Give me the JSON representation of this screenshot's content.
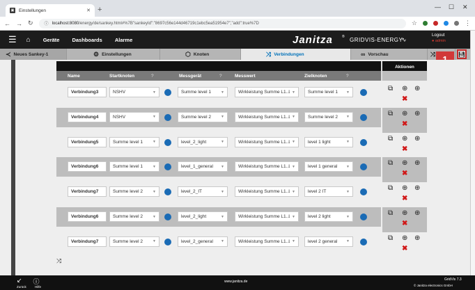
{
  "browser": {
    "tab_title": "Einstellungen",
    "url_host": "localhost:8080",
    "url_path": "/energy/de/sankey.html#%7B\"sankeyId\":\"8697c56e144d46719c1ebc5ea51954e7\",\"add\":true%7D"
  },
  "header": {
    "nav": [
      "Geräte",
      "Dashboards",
      "Alarme"
    ],
    "brand": "Janitza",
    "product": "GRIDVIS-ENERGY",
    "logout_label": "Logout",
    "user": "admin"
  },
  "tabs": {
    "back_label": "Neues Sankey-1",
    "items": [
      {
        "label": "Einstellungen",
        "icon": "gear-icon"
      },
      {
        "label": "Knoten",
        "icon": "node-icon"
      },
      {
        "label": "Verbindungen",
        "icon": "shuffle-icon"
      },
      {
        "label": "Vorschau",
        "icon": "glasses-icon"
      }
    ],
    "active": "Verbindungen",
    "callout_number": "1"
  },
  "table": {
    "headers": {
      "name": "Name",
      "start": "Startknoten",
      "device": "Messgerät",
      "value": "Messwert",
      "target": "Zielknoten",
      "actions": "Aktionen",
      "help": "?"
    },
    "rows": [
      {
        "name": "Verbindung3",
        "start": "NSHV",
        "device": "Summe level 1",
        "value": "Wirkleistung Summe L1..L3",
        "target": "Summe level 1"
      },
      {
        "name": "Verbindung4",
        "start": "NSHV",
        "device": "Summe level 2",
        "value": "Wirkleistung Summe L1..L3",
        "target": "Summe level 2"
      },
      {
        "name": "Verbindung5",
        "start": "Summe level 1",
        "device": "level_2_light",
        "value": "Wirkleistung Summe L1..L3",
        "target": "level 1 light"
      },
      {
        "name": "Verbindung6",
        "start": "Summe level 1",
        "device": "level_1_general",
        "value": "Wirkleistung Summe L1..L3",
        "target": "level 1 general"
      },
      {
        "name": "Verbindung7",
        "start": "Summe level 2",
        "device": "level_2_IT",
        "value": "Wirkleistung Summe L1..L3",
        "target": "level 2 IT"
      },
      {
        "name": "Verbindung6",
        "start": "Summe level 2",
        "device": "level_2_light",
        "value": "Wirkleistung Summe L1..L3",
        "target": "level 2 light"
      },
      {
        "name": "Verbindung7",
        "start": "Summe level 2",
        "device": "level_2_general",
        "value": "Wirkleistung Summe L1..L3",
        "target": "level 2 general"
      }
    ]
  },
  "footer": {
    "back_label": "Zurück",
    "help_label": "Hilfe",
    "url": "www.janitza.de",
    "version": "GridVis 7.3",
    "copyright": "© Janitza electronics GmbH"
  },
  "colors": {
    "accent": "#0071b9",
    "dot": "#1a6bb5",
    "delete": "#d11818",
    "callout": "#d13838"
  }
}
